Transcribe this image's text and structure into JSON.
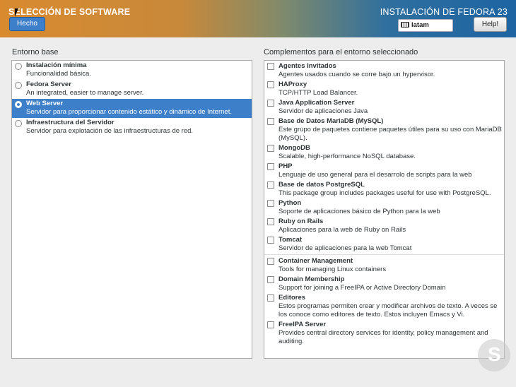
{
  "header": {
    "title": "SELECCIÓN DE SOFTWARE",
    "install_title": "INSTALACIÓN DE FEDORA 23",
    "done_label": "Hecho",
    "keyboard_layout": "latam",
    "help_label": "Help!"
  },
  "base_env": {
    "label": "Entorno base",
    "items": [
      {
        "name": "Instalación mínima",
        "desc": "Funcionalidad básica."
      },
      {
        "name": "Fedora Server",
        "desc": "An integrated, easier to manage server."
      },
      {
        "name": "Web Server",
        "desc": "Servidor para proporcionar contenido estático y dinámico de Internet."
      },
      {
        "name": "Infraestructura del Servidor",
        "desc": "Servidor para  explotación de las infraestructuras de red."
      }
    ]
  },
  "addons": {
    "label": "Complementos para el entorno seleccionado",
    "items": [
      {
        "name": "Agentes Invitados",
        "desc": "Agentes usados cuando se corre bajo un hypervisor."
      },
      {
        "name": "HAProxy",
        "desc": "TCP/HTTP Load Balancer."
      },
      {
        "name": "Java Application Server",
        "desc": "Servidor de aplicaciones Java"
      },
      {
        "name": "Base de Datos MariaDB (MySQL)",
        "desc": "Este grupo de paquetes contiene paquetes útiles para su uso con MariaDB (MySQL)."
      },
      {
        "name": "MongoDB",
        "desc": "Scalable, high-performance NoSQL database."
      },
      {
        "name": "PHP",
        "desc": "Lenguaje de uso general para el desarrolo de scripts para la web"
      },
      {
        "name": "Base de datos PostgreSQL",
        "desc": "This package group includes packages useful for use with PostgreSQL."
      },
      {
        "name": "Python",
        "desc": "Soporte de aplicaciones básico de Python para la web"
      },
      {
        "name": "Ruby on Rails",
        "desc": "Aplicaciones para la web de Ruby on Rails"
      },
      {
        "name": "Tomcat",
        "desc": "Servidor de aplicaciones para la web Tomcat"
      },
      {
        "name": "Container Management",
        "desc": "Tools for managing Linux containers"
      },
      {
        "name": "Domain Membership",
        "desc": "Support for joining a FreeIPA or Active Directory Domain"
      },
      {
        "name": "Editores",
        "desc": "Estos programas permiten crear y modificar archivos de texto. A veces se los conoce como editores de texto. Estos incluyen Emacs y Vi."
      },
      {
        "name": "FreeIPA Server",
        "desc": "Provides central directory services for identity, policy management and auditing."
      }
    ]
  },
  "colors": {
    "accent": "#3d7fc9",
    "header_left": "#d98a2f",
    "header_right": "#1d64a3"
  }
}
